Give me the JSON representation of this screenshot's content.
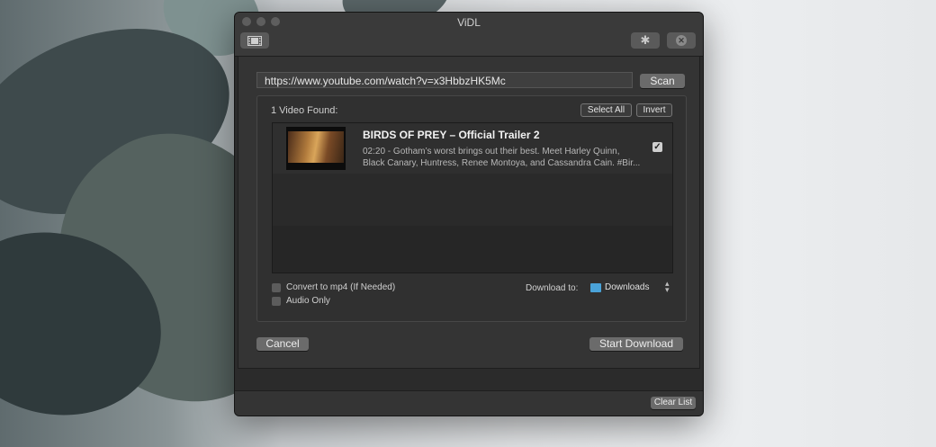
{
  "window": {
    "title": "ViDL"
  },
  "toolbar": {
    "film_icon": "film-icon",
    "gear_icon": "gear-icon",
    "close_icon": "close-circle-icon"
  },
  "url_field": {
    "value": "https://www.youtube.com/watch?v=x3HbbzHK5Mc"
  },
  "scan_button": {
    "label": "Scan"
  },
  "results": {
    "found_label": "1 Video Found:",
    "select_all_label": "Select All",
    "invert_label": "Invert",
    "videos": [
      {
        "title": "BIRDS OF PREY – Official Trailer 2",
        "description_line1": "02:20 - Gotham’s worst brings out their best. Meet Harley Quinn,",
        "description_line2": "Black Canary, Huntress, Renee Montoya, and Cassandra Cain. #Bir...",
        "checked": true
      }
    ]
  },
  "options": {
    "convert_mp4": "Convert to mp4 (If Needed)",
    "audio_only": "Audio Only",
    "download_to_label": "Download to:",
    "download_folder": "Downloads"
  },
  "actions": {
    "cancel_label": "Cancel",
    "start_label": "Start Download"
  },
  "footer": {
    "clear_label": "Clear List"
  }
}
